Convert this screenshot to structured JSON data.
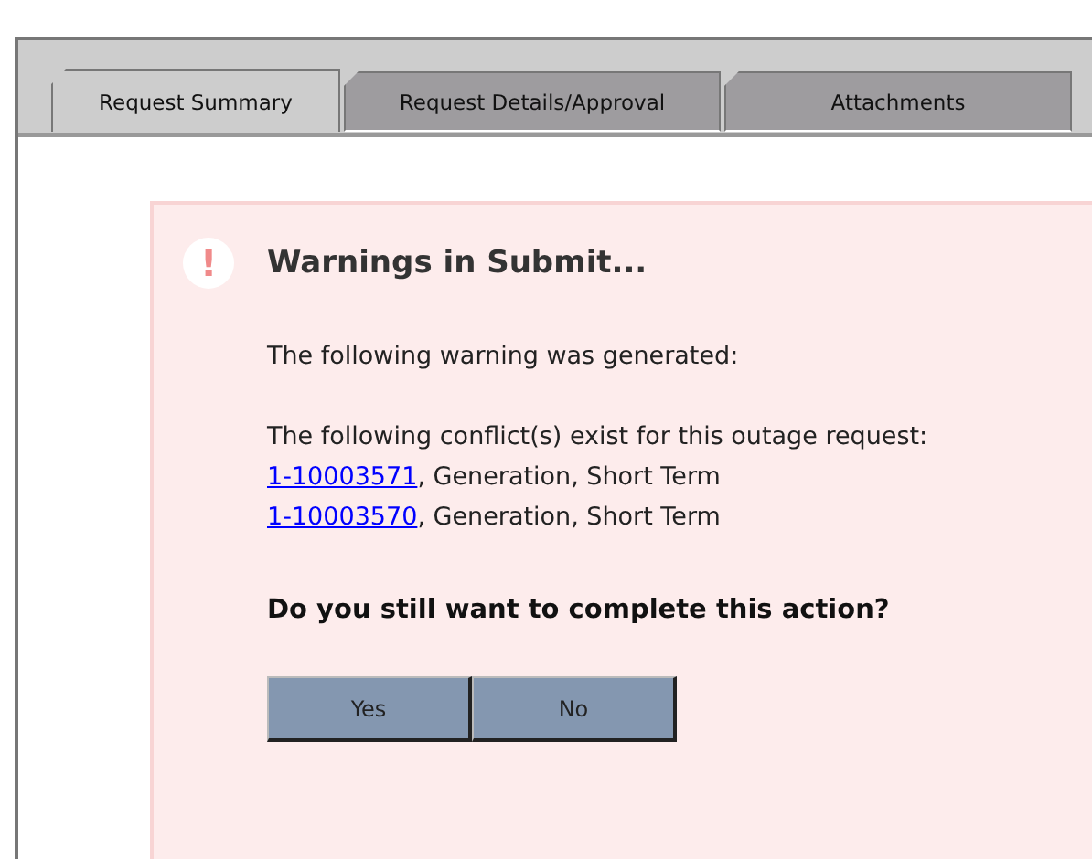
{
  "tabs": [
    {
      "label": "Request Summary",
      "selected": true
    },
    {
      "label": "Request Details/Approval",
      "selected": false
    },
    {
      "label": "Attachments",
      "selected": false
    }
  ],
  "warning": {
    "icon": "!",
    "title": "Warnings in Submit...",
    "message": "The following warning was generated:",
    "conflicts_intro": "The following conflict(s) exist for this outage request:",
    "conflicts": [
      {
        "link": "1-10003571",
        "text": ", Generation, Short Term"
      },
      {
        "link": "1-10003570",
        "text": ", Generation, Short Term"
      }
    ],
    "question": "Do you still want to complete this action?",
    "buttons": [
      "Yes",
      "No"
    ]
  }
}
